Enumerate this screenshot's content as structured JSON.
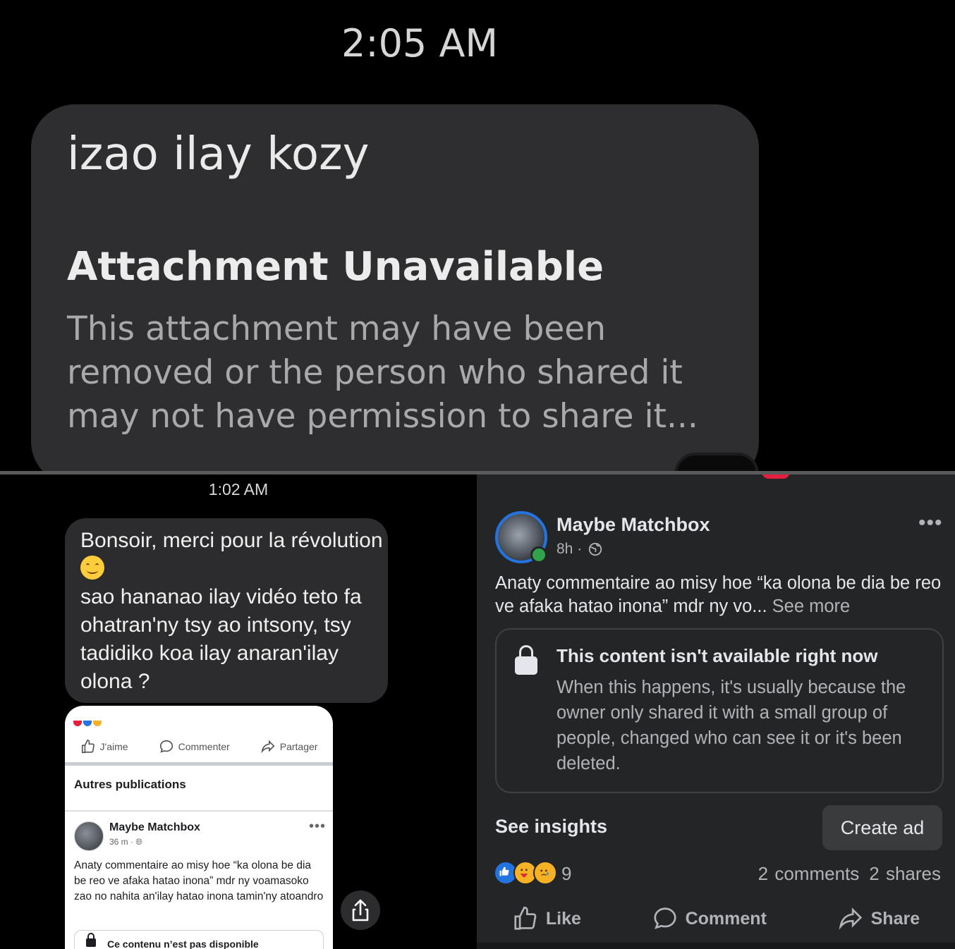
{
  "top": {
    "time": "2:05 AM",
    "message": "izao ilay kozy",
    "attachment_title": "Attachment Unavailable",
    "attachment_desc": "This attachment may have been removed or the person who shared it may not have permission to share it..."
  },
  "bottom_left": {
    "time": "1:02 AM",
    "message_line1": "Bonsoir, merci pour la révolution ",
    "message_line2": "sao hananao ilay vidéo teto fa ohatran'ny tsy ao intsony, tsy tadidiko koa ilay anaran'ilay olona ?",
    "emoji": "smiling-face",
    "screenshot": {
      "like": "J'aime",
      "comment": "Commenter",
      "share": "Partager",
      "section_title": "Autres publications",
      "page_name": "Maybe Matchbox",
      "meta": "36 m ·",
      "dots": "•••",
      "body": "Anaty commentaire ao misy hoe “ka olona be dia be reo ve afaka hatao inona” mdr ny voamasoko zao no nahita an'ilay hatao inona tamin'ny atoandro",
      "unavailable": "Ce contenu n’est pas disponible"
    }
  },
  "bottom_right": {
    "page_name": "Maybe Matchbox",
    "time": "8h ·",
    "dots": "•••",
    "body": "Anaty commentaire ao misy hoe “ka olona be dia be reo ve afaka hatao inona” mdr ny vo...",
    "see_more": "See more",
    "unavailable_title": "This content isn't available right now",
    "unavailable_desc": "When this happens, it's usually because the owner only shared it with a small group of people, changed who can see it or it's been deleted.",
    "see_insights": "See insights",
    "create_ad": "Create ad",
    "reaction_count": "9",
    "comments": "2 comments",
    "shares": "2 shares",
    "like": "Like",
    "comment": "Comment",
    "share": "Share",
    "colors": {
      "accent": "#2374e1",
      "online": "#31a24c"
    }
  }
}
